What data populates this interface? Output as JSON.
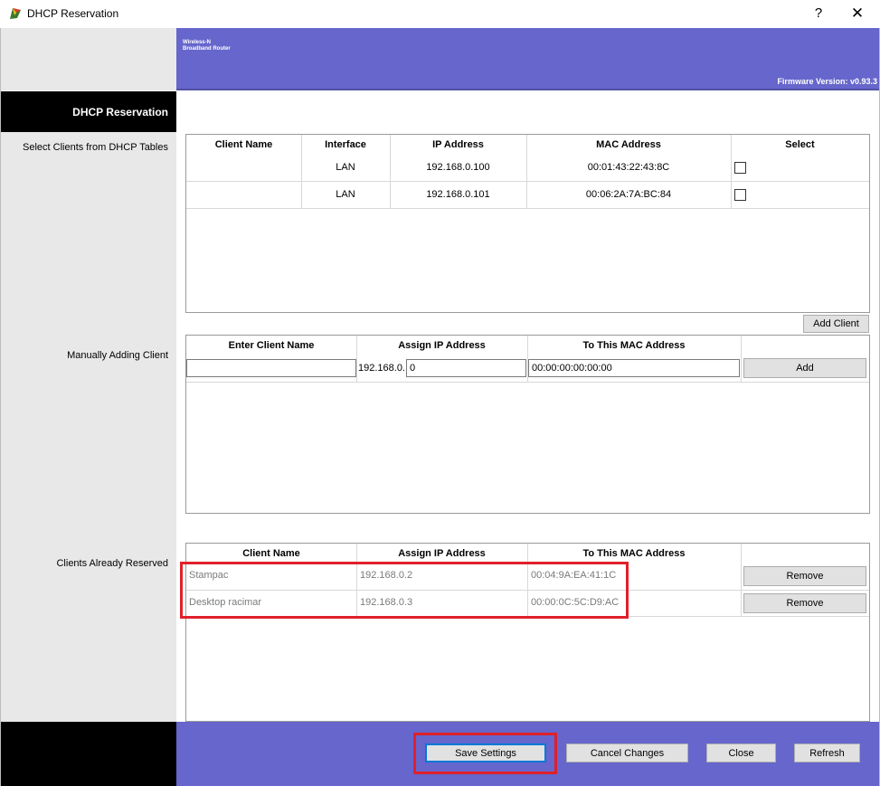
{
  "window": {
    "title": "DHCP Reservation",
    "help_label": "?",
    "close_label": "✕"
  },
  "header": {
    "brand_line1": "Wireless-N",
    "brand_line2": "Broadband Router",
    "firmware": "Firmware Version: v0.93.3"
  },
  "section_title": "DHCP Reservation",
  "labels": {
    "select_clients": "Select Clients from DHCP Tables",
    "manually_adding": "Manually Adding Client",
    "already_reserved": "Clients Already Reserved"
  },
  "dhcp_table": {
    "headers": [
      "Client Name",
      "Interface",
      "IP Address",
      "MAC Address",
      "Select"
    ],
    "rows": [
      {
        "client_name": "",
        "interface": "LAN",
        "ip": "192.168.0.100",
        "mac": "00:01:43:22:43:8C",
        "selected": false
      },
      {
        "client_name": "",
        "interface": "LAN",
        "ip": "192.168.0.101",
        "mac": "00:06:2A:7A:BC:84",
        "selected": false
      }
    ]
  },
  "add_client_button": "Add Client",
  "manual_table": {
    "headers": [
      "Enter Client Name",
      "Assign IP Address",
      "To This MAC Address"
    ],
    "client_name_value": "",
    "ip_prefix": "192.168.0.",
    "ip_suffix_value": "0",
    "mac_value": "00:00:00:00:00:00",
    "add_button": "Add"
  },
  "reserved_table": {
    "headers": [
      "Client Name",
      "Assign IP Address",
      "To This MAC Address"
    ],
    "rows": [
      {
        "client_name": "Stampac",
        "ip": "192.168.0.2",
        "mac": "00:04:9A:EA:41:1C",
        "remove": "Remove"
      },
      {
        "client_name": "Desktop racimar",
        "ip": "192.168.0.3",
        "mac": "00:00:0C:5C:D9:AC",
        "remove": "Remove"
      }
    ]
  },
  "footer": {
    "save": "Save Settings",
    "cancel": "Cancel Changes",
    "close": "Close",
    "refresh": "Refresh"
  },
  "colors": {
    "accent": "#6666cc",
    "highlight": "#e0202a",
    "side_panel": "#e8e8e8"
  }
}
